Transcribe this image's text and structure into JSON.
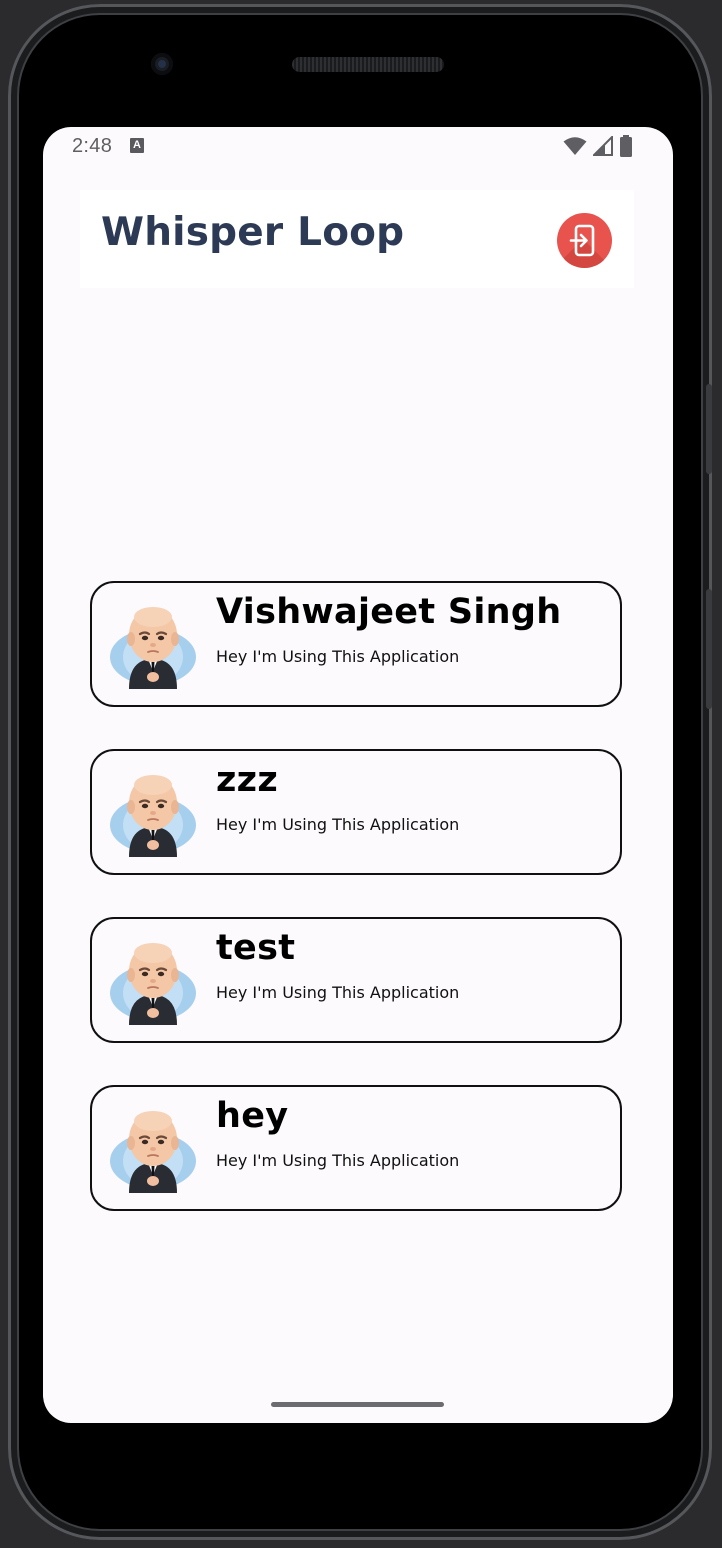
{
  "status_bar": {
    "time": "2:48",
    "notification_icon": "a-keyboard-icon",
    "icons": [
      "wifi-icon",
      "cell-signal-icon",
      "battery-icon"
    ]
  },
  "header": {
    "title": "Whisper Loop",
    "logout_icon": "logout-icon"
  },
  "users": [
    {
      "name": "Vishwajeet Singh",
      "status": "Hey I'm Using This Application",
      "avatar": "boss-baby-avatar"
    },
    {
      "name": "zzz",
      "status": "Hey I'm Using This Application",
      "avatar": "boss-baby-avatar"
    },
    {
      "name": "test",
      "status": "Hey I'm Using This Application",
      "avatar": "boss-baby-avatar"
    },
    {
      "name": "hey",
      "status": "Hey I'm Using This Application",
      "avatar": "boss-baby-avatar"
    }
  ],
  "colors": {
    "title": "#2c3a55",
    "logout_button": "#e8534d",
    "screen_background": "#fcfafd",
    "card_border": "#101010"
  }
}
